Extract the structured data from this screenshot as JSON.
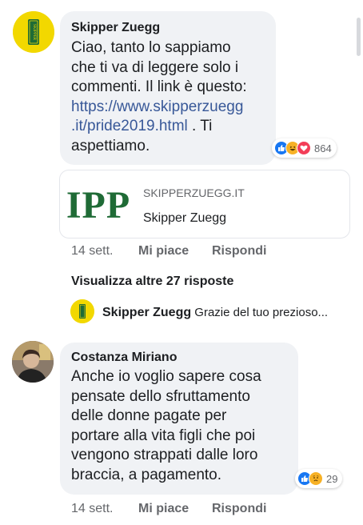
{
  "comments": [
    {
      "author": "Skipper Zuegg",
      "avatar_text": "SKIPPER",
      "lines": [
        "Ciao, tanto lo sappiamo",
        "che ti va di leggere solo i",
        "commenti. Il link è questo:"
      ],
      "link_line1": "https://www.skipperzuegg",
      "link_line2": ".it/pride2019.html",
      "after_link": " . Ti",
      "last_line": "aspettiamo.",
      "reactions": [
        "like-icon",
        "haha-icon",
        "love-icon"
      ],
      "reaction_count": "864",
      "link_preview": {
        "logo_text": "IPP",
        "domain": "SKIPPERZUEGG.IT",
        "title": "Skipper Zuegg"
      },
      "time": "14 sett.",
      "like_label": "Mi piace",
      "reply_label": "Rispondi"
    },
    {
      "author": "Costanza Miriano",
      "lines": [
        "Anche io voglio sapere cosa",
        "pensate dello sfruttamento",
        "delle donne pagate per",
        "portare alla vita figli che poi",
        "vengono strappati dalle loro",
        "braccia, a pagamento."
      ],
      "reactions": [
        "like-icon",
        "sad-icon"
      ],
      "reaction_count": "29",
      "time": "14 sett.",
      "like_label": "Mi piace",
      "reply_label": "Rispondi"
    }
  ],
  "more_replies_label": "Visualizza altre 27 risposte",
  "reply_preview": {
    "author": "Skipper Zuegg",
    "text": "Grazie del tuo prezioso..."
  },
  "colors": {
    "bubble": "#f0f2f5",
    "link": "#385898",
    "meta": "#65676b",
    "like_blue": "#1877f2",
    "love_red": "#f33e58",
    "emoji_yellow": "#f7b125",
    "brand_yellow": "#f2d800",
    "brand_green": "#1f6b36"
  }
}
